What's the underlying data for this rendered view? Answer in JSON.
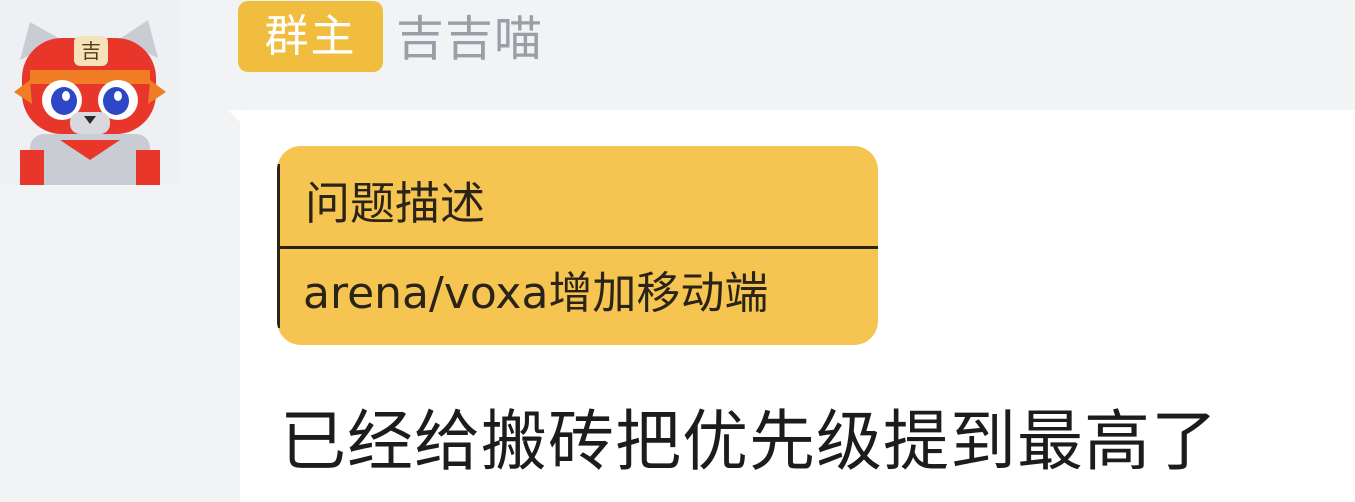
{
  "sender": {
    "role_badge": "群主",
    "name": "吉吉喵",
    "avatar_icon": "cat-mascot-avatar",
    "badge_color": "#f0bd3f"
  },
  "message": {
    "card": {
      "header": "问题描述",
      "cell": "arena/voxa增加移动端",
      "background_color": "#f6c450"
    },
    "text": "已经给搬砖把优先级提到最高了"
  },
  "colors": {
    "page_background": "#f2f3f5",
    "bubble_background": "#ffffff",
    "name_color": "#9a9ea6"
  }
}
